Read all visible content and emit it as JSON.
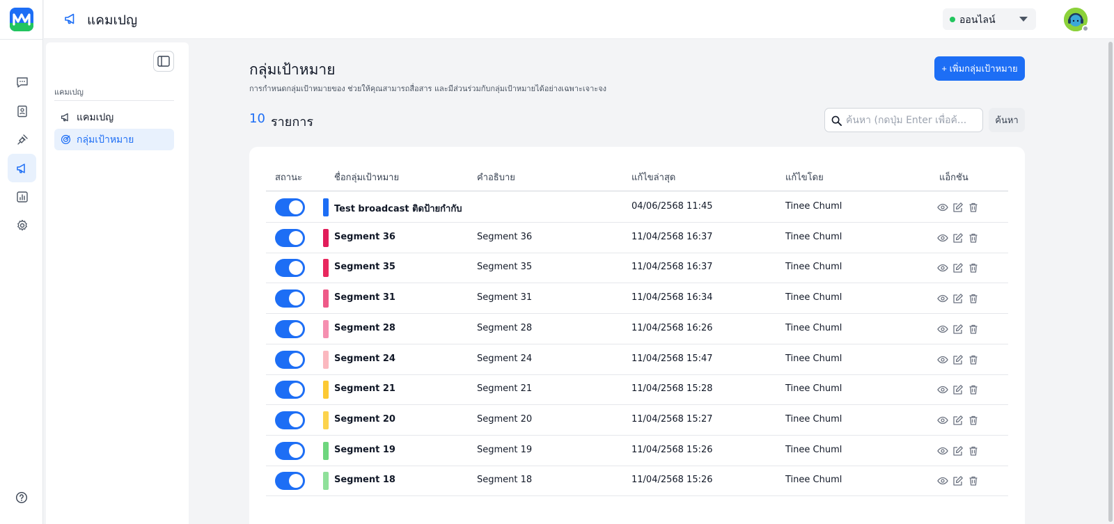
{
  "topbar": {
    "title": "แคมเปญ",
    "status": {
      "label": "ออนไลน์",
      "color": "#22c55e"
    }
  },
  "rail": {
    "items": [
      {
        "icon": "chat-icon"
      },
      {
        "icon": "contacts-icon"
      },
      {
        "icon": "plug-icon"
      },
      {
        "icon": "megaphone-icon",
        "active": true
      },
      {
        "icon": "report-icon"
      },
      {
        "icon": "gear-icon"
      }
    ],
    "help_icon": "help-icon"
  },
  "subnav": {
    "section_label": "แคมเปญ",
    "items": [
      {
        "label": "แคมเปญ",
        "icon": "megaphone-icon",
        "active": false
      },
      {
        "label": "กลุ่มเป้าหมาย",
        "icon": "target-icon",
        "active": true
      }
    ]
  },
  "main": {
    "title": "กลุ่มเป้าหมาย",
    "subtitle": "การกำหนดกลุ่มเป้าหมายของ ช่วยให้คุณสามารถสื่อสาร และมีส่วนร่วมกับกลุ่มเป้าหมายได้อย่างเฉพาะเจาะจง",
    "add_button": "+ เพิ่มกลุ่มเป้าหมาย",
    "count": "10",
    "count_label": "รายการ",
    "search": {
      "placeholder": "ค้นหา (กดปุ่ม Enter เพื่อค้...",
      "value": ""
    },
    "search_button": "ค้นหา"
  },
  "table": {
    "columns": [
      "สถานะ",
      "ชื่อกลุ่มเป้าหมาย",
      "คำอธิบาย",
      "แก้ไขล่าสุด",
      "แก้ไขโดย",
      "แอ็กชัน"
    ],
    "rows": [
      {
        "enabled": true,
        "color": "#1d6ef5",
        "name": "Test broadcast ติดป้ายกำกับ",
        "description": "",
        "updated": "04/06/2568 11:45",
        "updated_by": "Tinee Chuml"
      },
      {
        "enabled": true,
        "color": "#e11d5a",
        "name": "Segment 36",
        "description": "Segment 36",
        "updated": "11/04/2568 16:37",
        "updated_by": "Tinee Chuml"
      },
      {
        "enabled": true,
        "color": "#e8285e",
        "name": "Segment 35",
        "description": "Segment 35",
        "updated": "11/04/2568 16:37",
        "updated_by": "Tinee Chuml"
      },
      {
        "enabled": true,
        "color": "#ee5a88",
        "name": "Segment 31",
        "description": "Segment 31",
        "updated": "11/04/2568 16:34",
        "updated_by": "Tinee Chuml"
      },
      {
        "enabled": true,
        "color": "#f58fb0",
        "name": "Segment 28",
        "description": "Segment 28",
        "updated": "11/04/2568 16:26",
        "updated_by": "Tinee Chuml"
      },
      {
        "enabled": true,
        "color": "#fbb8bf",
        "name": "Segment 24",
        "description": "Segment 24",
        "updated": "11/04/2568 15:47",
        "updated_by": "Tinee Chuml"
      },
      {
        "enabled": true,
        "color": "#fcc934",
        "name": "Segment 21",
        "description": "Segment 21",
        "updated": "11/04/2568 15:28",
        "updated_by": "Tinee Chuml"
      },
      {
        "enabled": true,
        "color": "#fcd34d",
        "name": "Segment 20",
        "description": "Segment 20",
        "updated": "11/04/2568 15:27",
        "updated_by": "Tinee Chuml"
      },
      {
        "enabled": true,
        "color": "#6ed67e",
        "name": "Segment 19",
        "description": "Segment 19",
        "updated": "11/04/2568 15:26",
        "updated_by": "Tinee Chuml"
      },
      {
        "enabled": true,
        "color": "#8fe09a",
        "name": "Segment 18",
        "description": "Segment 18",
        "updated": "11/04/2568 15:26",
        "updated_by": "Tinee Chuml"
      }
    ]
  },
  "colors": {
    "accent": "#1d6ef5",
    "online": "#22c55e"
  }
}
